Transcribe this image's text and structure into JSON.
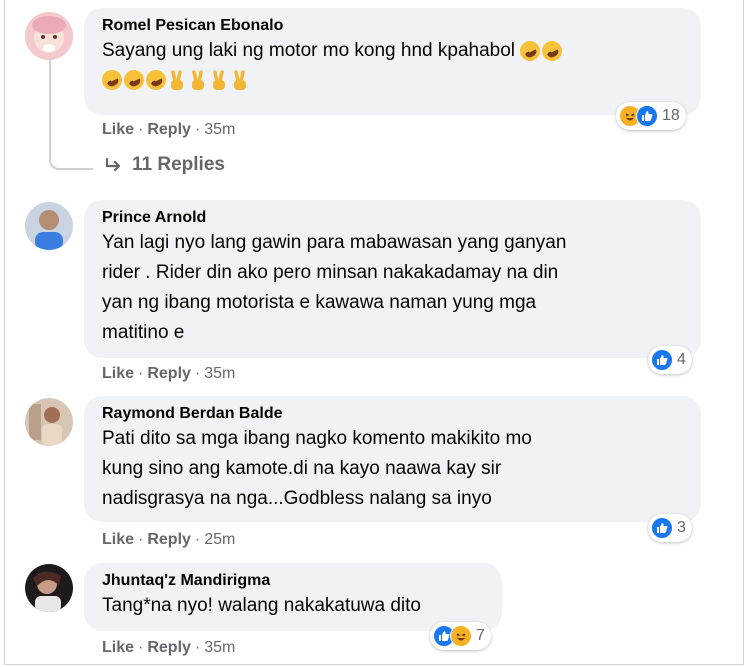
{
  "comments": [
    {
      "author": "Romel Pesican Ebonalo",
      "text_line1": "Sayang ung laki ng motor mo kong hnd kpahabol",
      "emoji_line1": [
        "rofl-emoji",
        "rofl-emoji"
      ],
      "emoji_line2": [
        "rofl-emoji",
        "rofl-emoji",
        "rofl-emoji",
        "victory-hand-emoji",
        "victory-hand-emoji",
        "victory-hand-emoji",
        "victory-hand-emoji"
      ],
      "actions": {
        "like": "Like",
        "reply": "Reply",
        "time": "35m"
      },
      "reactions": {
        "icons": [
          "haha-icon",
          "like-icon"
        ],
        "count": "18"
      },
      "replies_label": "11 Replies"
    },
    {
      "author": "Prince Arnold",
      "lines": [
        "Yan lagi nyo lang gawin para mabawasan yang ganyan",
        "rider . Rider din ako pero minsan nakakadamay na din",
        "yan ng ibang motorista e kawawa naman yung mga",
        "matitino e"
      ],
      "actions": {
        "like": "Like",
        "reply": "Reply",
        "time": "35m"
      },
      "reactions": {
        "icons": [
          "like-icon"
        ],
        "count": "4"
      }
    },
    {
      "author": "Raymond Berdan Balde",
      "lines": [
        "Pati dito sa mga ibang nagko komento makikito mo",
        "kung sino ang kamote.di na kayo naawa kay sir",
        "nadisgrasya na nga...Godbless nalang sa inyo"
      ],
      "actions": {
        "like": "Like",
        "reply": "Reply",
        "time": "25m"
      },
      "reactions": {
        "icons": [
          "like-icon"
        ],
        "count": "3"
      }
    },
    {
      "author": "Jhuntaq'z Mandirigma",
      "lines": [
        "Tang*na nyo! walang nakakatuwa dito"
      ],
      "actions": {
        "like": "Like",
        "reply": "Reply",
        "time": "35m"
      },
      "reactions": {
        "icons": [
          "like-icon",
          "haha-icon"
        ],
        "count": "7"
      }
    }
  ],
  "colors": {
    "bubble": "#f0f2f5",
    "meta": "#65676b",
    "like": "#1877f2",
    "haha": "#f7b125"
  }
}
